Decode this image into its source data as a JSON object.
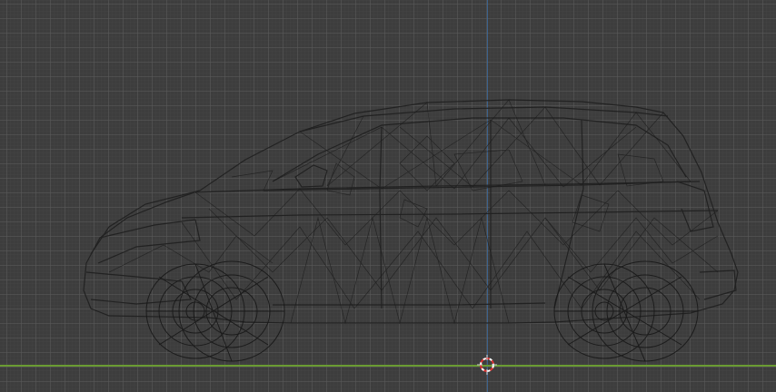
{
  "viewport": {
    "view": "3D viewport",
    "shading": "wireframe",
    "object": "car",
    "colors": {
      "background": "#3d3d3d",
      "grid": "#5a5a5a",
      "wire": "#1e1e1e",
      "axis_y": "#6a9b32",
      "axis_z": "#3c6fa8",
      "cursor_red": "#e03030",
      "cursor_white": "#ffffff"
    },
    "icons": [
      "3d-cursor-icon"
    ]
  }
}
